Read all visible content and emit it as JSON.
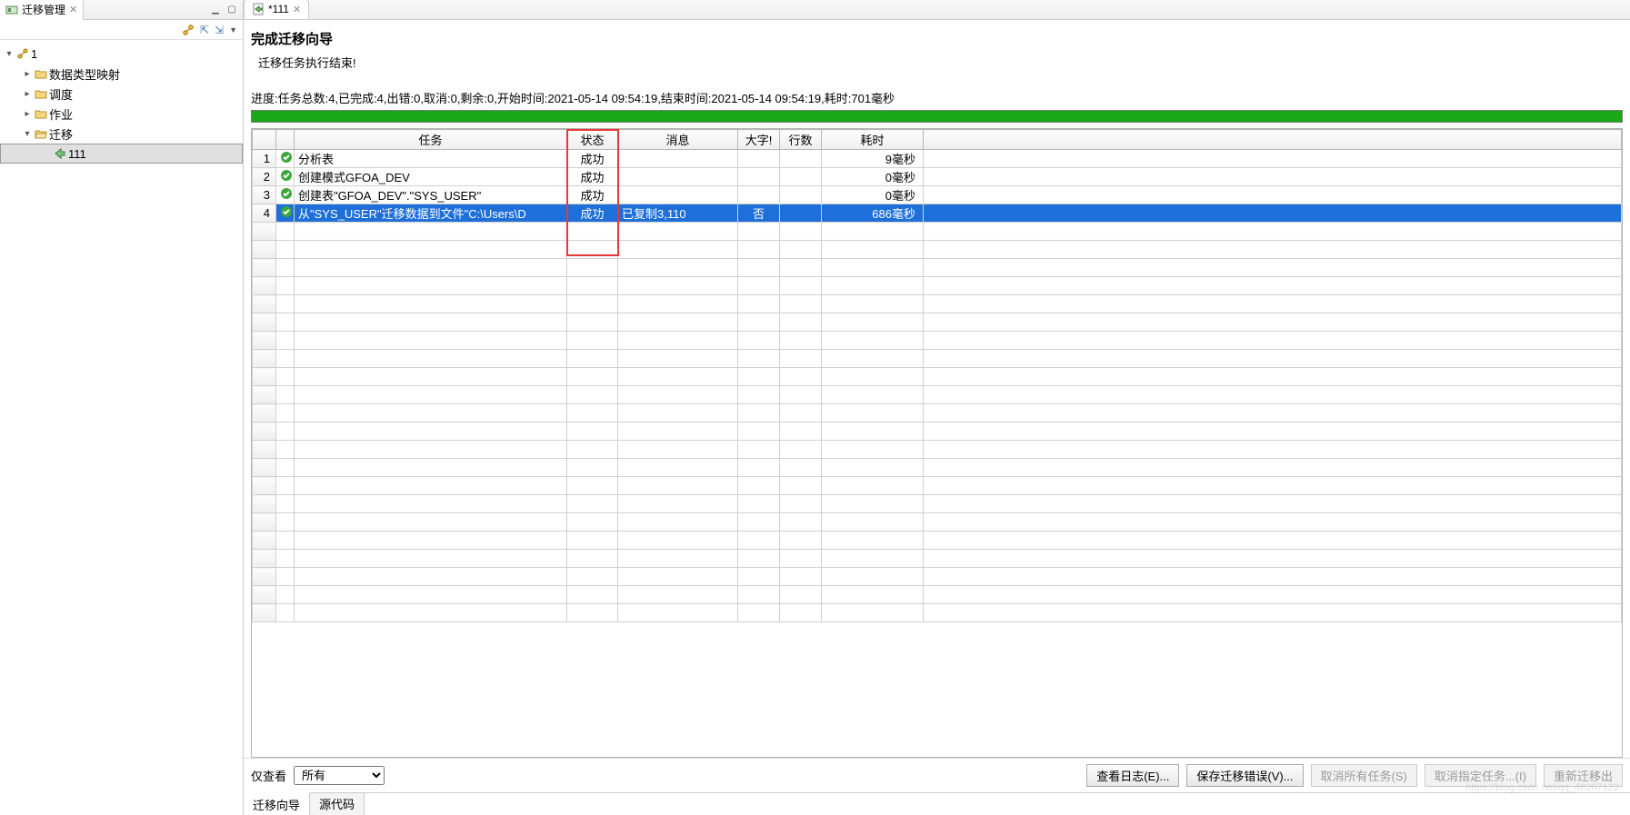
{
  "leftPanel": {
    "tabTitle": "迁移管理",
    "tree": {
      "root": {
        "label": "1"
      },
      "children": [
        {
          "label": "数据类型映射"
        },
        {
          "label": "调度"
        },
        {
          "label": "作业"
        },
        {
          "label": "迁移",
          "expanded": true,
          "children": [
            {
              "label": "111",
              "selected": true
            }
          ]
        }
      ]
    }
  },
  "editor": {
    "tabTitle": "*111",
    "wizardTitle": "完成迁移向导",
    "wizardSubtitle": "迁移任务执行结束!",
    "progressText": "进度:任务总数:4,已完成:4,出错:0,取消:0,剩余:0,开始时间:2021-05-14 09:54:19,结束时间:2021-05-14 09:54:19,耗时:701毫秒",
    "columns": {
      "rownum": "",
      "status": "",
      "task": "任务",
      "state": "状态",
      "message": "消息",
      "bigchar": "大字!",
      "rows": "行数",
      "elapsed": "耗时"
    },
    "rows": [
      {
        "n": "1",
        "ok": true,
        "task": "分析表",
        "state": "成功",
        "message": "",
        "bigchar": "",
        "rows": "",
        "elapsed": "9毫秒",
        "selected": false
      },
      {
        "n": "2",
        "ok": true,
        "task": "创建模式GFOA_DEV",
        "state": "成功",
        "message": "",
        "bigchar": "",
        "rows": "",
        "elapsed": "0毫秒",
        "selected": false
      },
      {
        "n": "3",
        "ok": true,
        "task": "创建表\"GFOA_DEV\".\"SYS_USER\"",
        "state": "成功",
        "message": "",
        "bigchar": "",
        "rows": "",
        "elapsed": "0毫秒",
        "selected": false
      },
      {
        "n": "4",
        "ok": true,
        "task": "从\"SYS_USER\"迁移数据到文件\"C:\\Users\\D",
        "state": "成功",
        "message": "已复制3,110",
        "bigchar": "否",
        "rows": "",
        "elapsed": "686毫秒",
        "selected": true
      }
    ]
  },
  "bottomBar": {
    "viewOnly": "仅查看",
    "filterValue": "所有",
    "buttons": {
      "viewLog": "查看日志(E)...",
      "saveErrors": "保存迁移错误(V)...",
      "cancelAll": "取消所有任务(S)",
      "cancelSelected": "取消指定任务...(I)",
      "restart": "重新迁移出"
    }
  },
  "bottomTabs": {
    "wizard": "迁移向导",
    "source": "源代码"
  },
  "watermark": "https://blog.csdn.net/qq_48207122"
}
